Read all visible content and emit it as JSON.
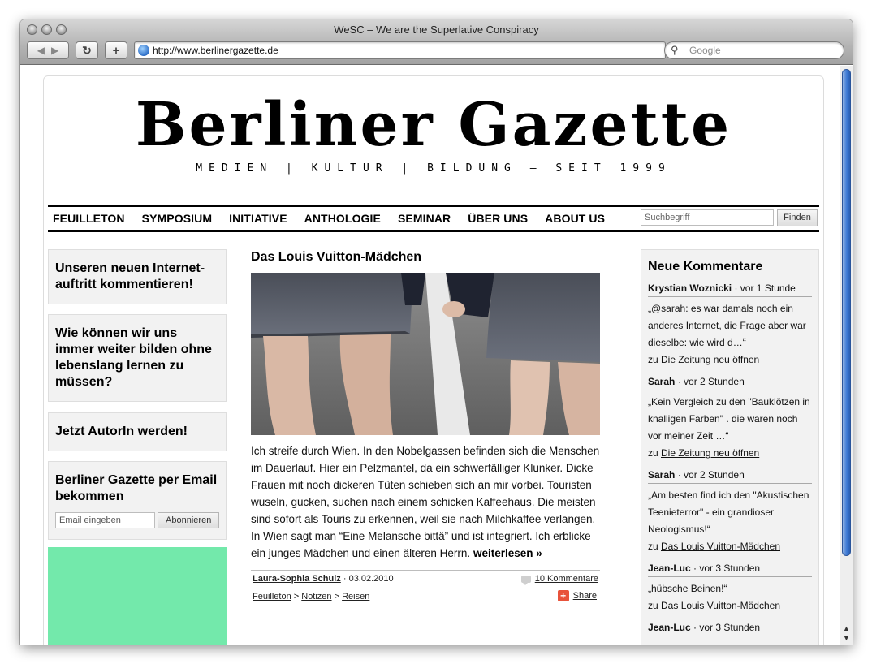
{
  "browser": {
    "window_title": "WeSC – We are the Superlative Conspiracy",
    "url": "http://www.berlinergazette.de",
    "search_placeholder": "Google",
    "back_icon": "back-arrow-icon",
    "forward_icon": "forward-arrow-icon",
    "reload_icon": "reload-icon",
    "add_icon": "plus-icon"
  },
  "site": {
    "logo": "Berliner Gazette",
    "tagline": "MEDIEN | KULTUR | BILDUNG – SEIT 1999"
  },
  "nav": {
    "items": [
      "FEUILLETON",
      "SYMPOSIUM",
      "INITIATIVE",
      "ANTHOLOGIE",
      "SEMINAR",
      "ÜBER UNS",
      "ABOUT US"
    ],
    "search_placeholder": "Suchbegriff",
    "search_button": "Finden"
  },
  "left": {
    "box1": "Unseren neuen Internet-auftritt kommentieren!",
    "box2": "Wie können wir uns immer weiter bilden ohne lebenslang lernen zu müssen?",
    "box3": "Jetzt AutorIn werden!",
    "box4_title": "Berliner Gazette per Email bekommen",
    "email_placeholder": "Email eingeben",
    "subscribe_button": "Abonnieren",
    "green_color": "#73e9ab"
  },
  "article": {
    "title": "Das Louis Vuitton-Mädchen",
    "text": "Ich streife durch Wien. In den Nobelgassen befinden sich die Menschen im Dauerlauf. Hier ein Pelzmantel, da ein schwerfälliger Klunker. Dicke Frauen mit noch dickeren Tüten schieben sich an mir vorbei. Touristen wuseln, gucken, suchen nach einem schicken Kaffeehaus. Die meisten sind sofort als Touris zu erkennen, weil sie nach Milchkaffee verlangen. In Wien sagt man “Eine Melansche bittä” und ist integriert. Ich erblicke ein junges Mädchen und einen älteren Herrn.",
    "more": "weiterlesen »",
    "author": "Laura-Sophia Schulz",
    "date_sep": " · 03.02.2010",
    "comments": "10 Kommentare",
    "cat1": "Feuilleton",
    "sep1": " > ",
    "cat2": "Notizen",
    "sep2": " > ",
    "cat3": "Reisen",
    "share": "Share"
  },
  "comments": {
    "title": "Neue Kommentare",
    "list": [
      {
        "name": "Krystian Woznicki",
        "time": " · vor 1 Stunde",
        "text": "„@sarah: es war damals noch ein anderes Internet, die Frage aber war dieselbe: wie wird d…“",
        "zu": "zu ",
        "link": "Die Zeitung neu öffnen"
      },
      {
        "name": "Sarah",
        "time": " · vor 2 Stunden",
        "text": "„Kein Vergleich zu den \"Bauklötzen in knalligen Farben\" . die waren noch vor meiner Zeit …“",
        "zu": "zu ",
        "link": "Die Zeitung neu öffnen"
      },
      {
        "name": "Sarah",
        "time": " · vor 2 Stunden",
        "text": "„Am besten find ich den \"Akustischen Teenieterror\" - ein grandioser Neologismus!“",
        "zu": "zu ",
        "link": "Das Louis Vuitton-Mädchen"
      },
      {
        "name": "Jean-Luc",
        "time": " · vor 3 Stunden",
        "text": "„hübsche Beinen!“",
        "zu": "zu ",
        "link": "Das Louis Vuitton-Mädchen"
      },
      {
        "name": "Jean-Luc",
        "time": " · vor 3 Stunden",
        "text": "",
        "zu": "",
        "link": ""
      }
    ]
  }
}
